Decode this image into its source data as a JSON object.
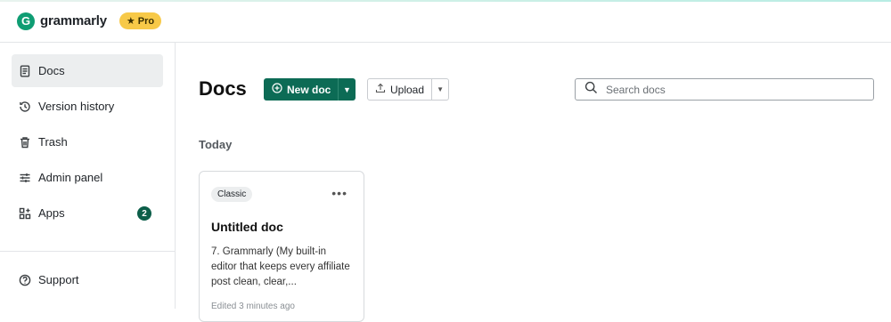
{
  "brand": {
    "name": "grammarly",
    "logo_letter": "G",
    "plan_badge": "Pro",
    "plan_icon": "star-icon"
  },
  "sidebar": {
    "items": [
      {
        "label": "Docs",
        "icon": "document-icon",
        "active": true
      },
      {
        "label": "Version history",
        "icon": "history-icon"
      },
      {
        "label": "Trash",
        "icon": "trash-icon"
      },
      {
        "label": "Admin panel",
        "icon": "sliders-icon"
      },
      {
        "label": "Apps",
        "icon": "apps-icon",
        "badge": "2"
      }
    ],
    "footer": {
      "label": "Support",
      "icon": "help-icon"
    }
  },
  "main": {
    "title": "Docs",
    "new_doc_label": "New doc",
    "upload_label": "Upload",
    "search_placeholder": "Search docs",
    "section_label": "Today",
    "documents": [
      {
        "badge": "Classic",
        "title": "Untitled doc",
        "snippet": "7. Grammarly (My built-in editor that keeps every affiliate post clean, clear,...",
        "edited": "Edited 3 minutes ago"
      }
    ]
  },
  "colors": {
    "accent": "#0c6b55",
    "pro_badge": "#f7c948",
    "active_nav": "#eceeef"
  }
}
